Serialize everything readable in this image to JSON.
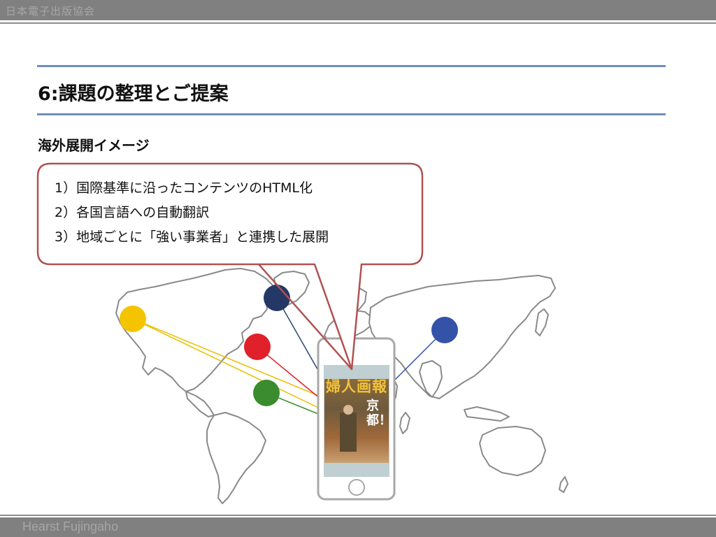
{
  "header": {
    "org_name": "日本電子出版協会"
  },
  "slide": {
    "title": "6:課題の整理とご提案",
    "subtitle": "海外展開イメージ"
  },
  "callout": {
    "items": [
      "1）国際基準に沿ったコンテンツのHTML化",
      "2）各国言語への自動翻訳",
      "3）地域ごとに「強い事業者」と連携した展開"
    ]
  },
  "magazine_cover": {
    "title_text": "婦人画報",
    "headline_text": "京都！"
  },
  "region_markers": [
    {
      "name": "yellow",
      "color": "#f5c400"
    },
    {
      "name": "navy",
      "color": "#243866"
    },
    {
      "name": "red",
      "color": "#e0202a"
    },
    {
      "name": "green",
      "color": "#3a8c2e"
    },
    {
      "name": "blue",
      "color": "#3453a8"
    }
  ],
  "footer": {
    "company": "Hearst Fujingaho"
  }
}
